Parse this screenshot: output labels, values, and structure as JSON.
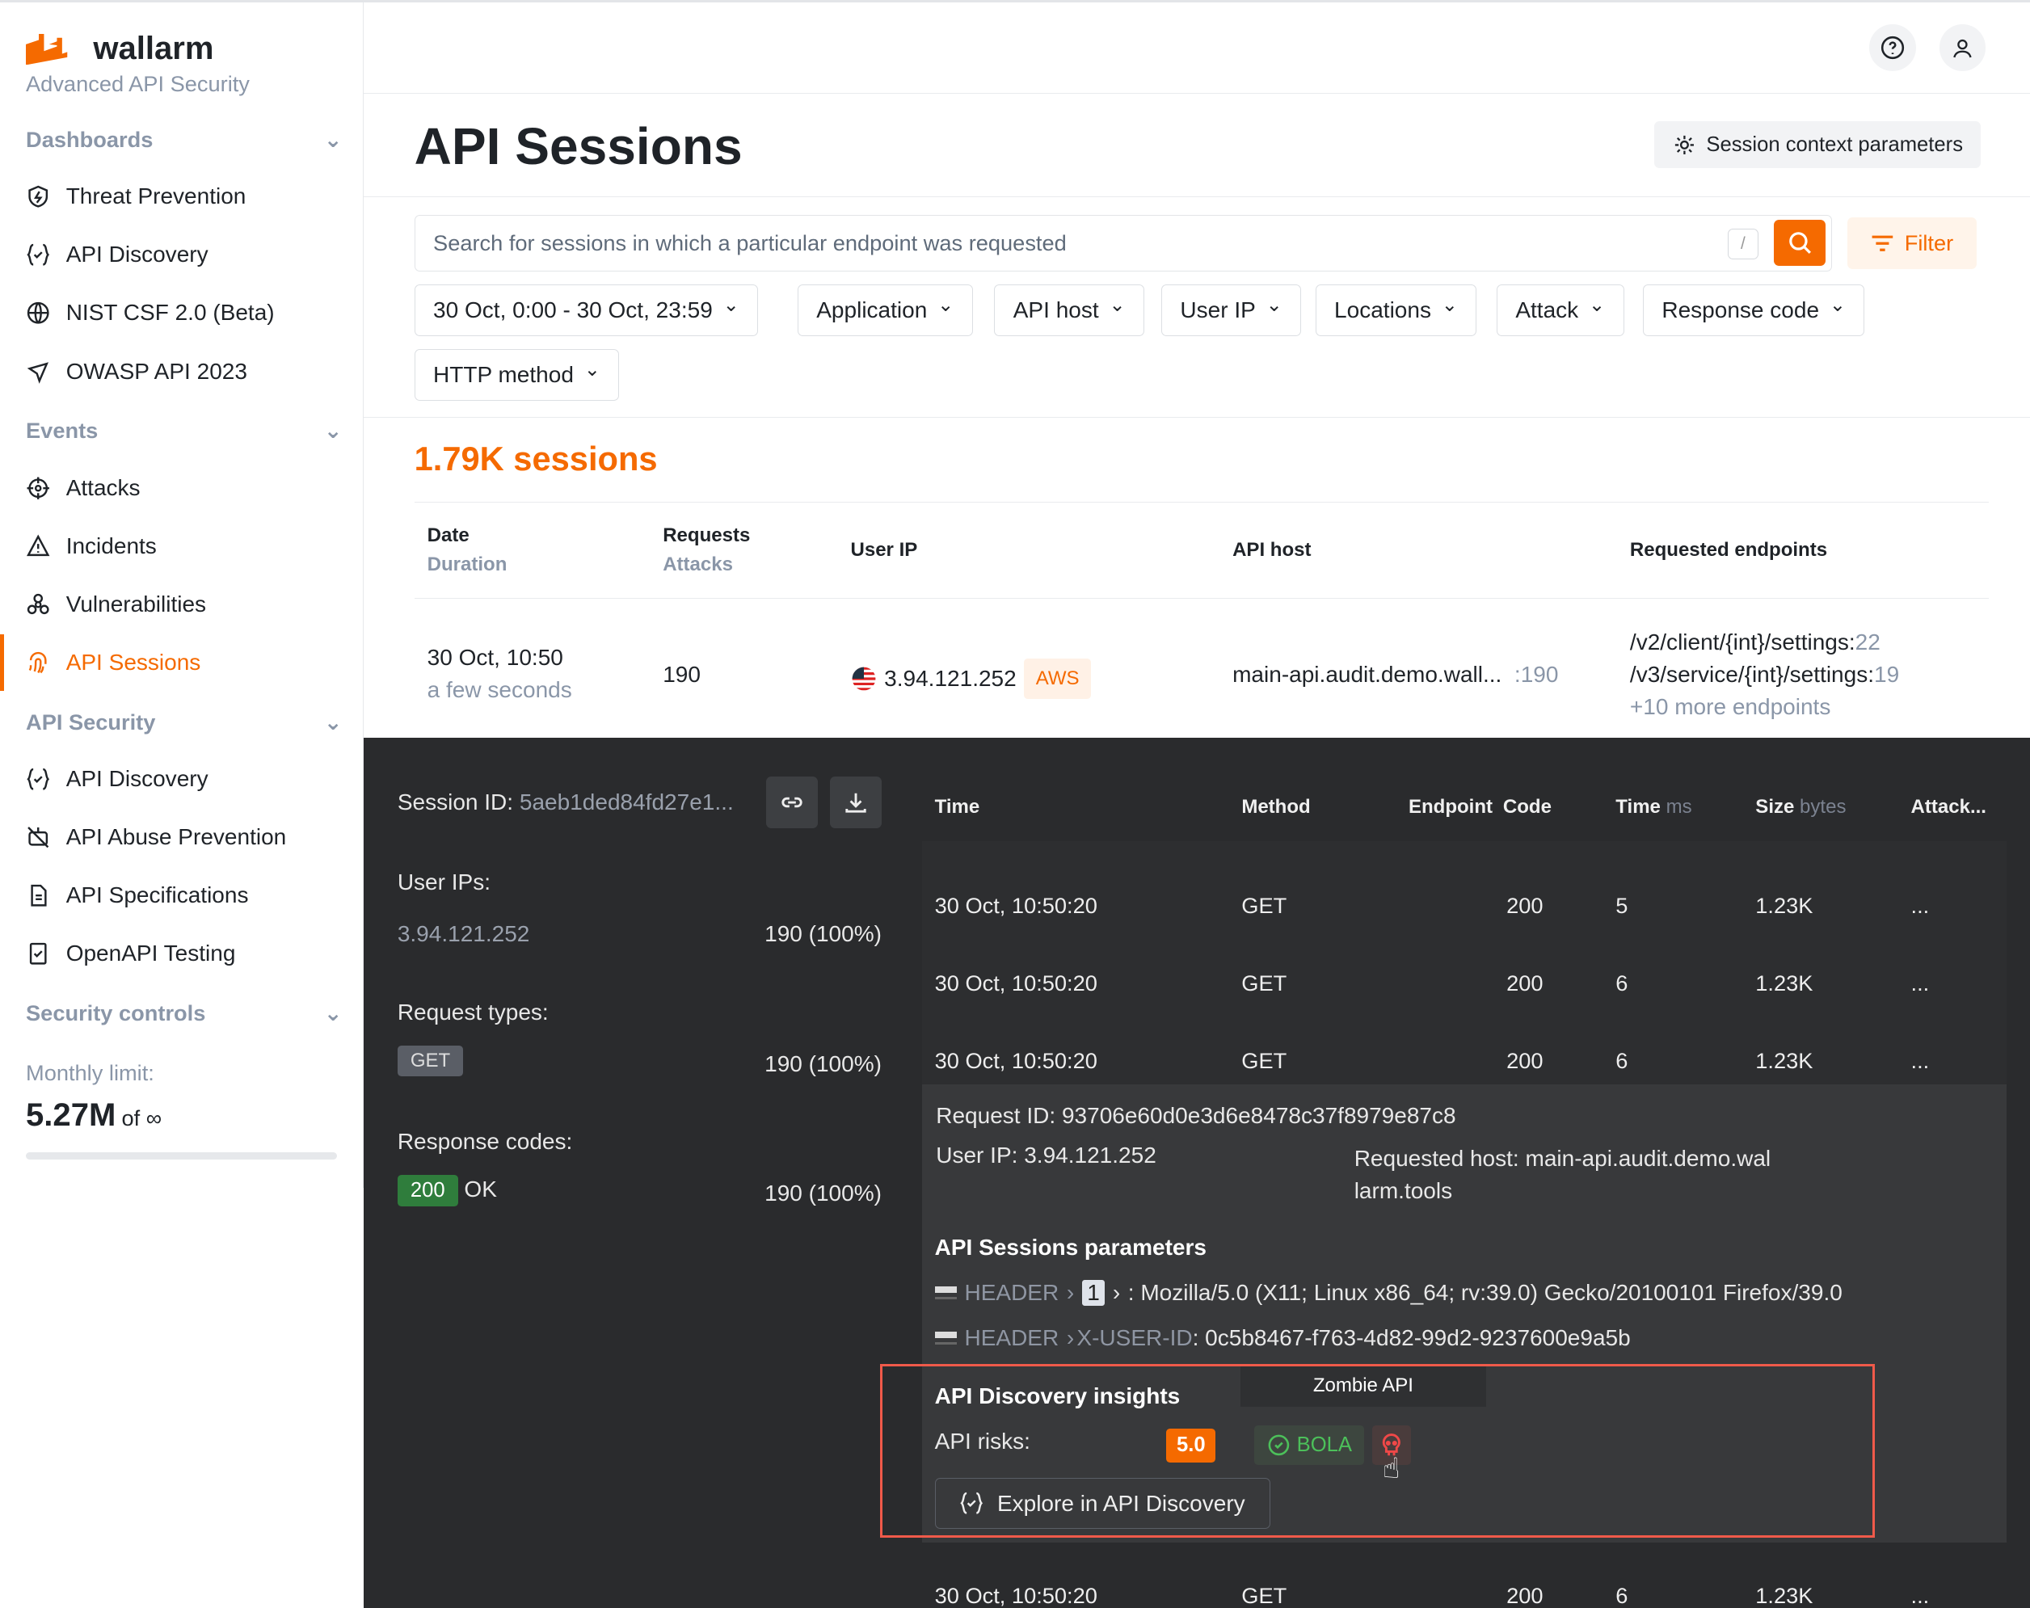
{
  "brand": {
    "name": "wallarm",
    "tagline": "Advanced API Security",
    "accent": "#f56a00"
  },
  "sidebar": {
    "sections": [
      {
        "label": "Dashboards"
      },
      {
        "label": "Events"
      },
      {
        "label": "API Security"
      },
      {
        "label": "Security controls"
      }
    ],
    "items": [
      {
        "label": "Threat Prevention",
        "icon": "shield-bolt-icon"
      },
      {
        "label": "API Discovery",
        "icon": "api-braces-icon"
      },
      {
        "label": "NIST CSF 2.0 (Beta)",
        "icon": "globe-icon"
      },
      {
        "label": "OWASP API 2023",
        "icon": "owasp-icon"
      },
      {
        "label": "Attacks",
        "icon": "crosshair-icon"
      },
      {
        "label": "Incidents",
        "icon": "warning-icon"
      },
      {
        "label": "Vulnerabilities",
        "icon": "biohazard-icon"
      },
      {
        "label": "API Sessions",
        "icon": "fingerprint-icon",
        "active": true
      },
      {
        "label": "API Discovery",
        "icon": "api-braces-icon"
      },
      {
        "label": "API Abuse Prevention",
        "icon": "bot-icon"
      },
      {
        "label": "API Specifications",
        "icon": "document-icon"
      },
      {
        "label": "OpenAPI Testing",
        "icon": "checklist-icon"
      }
    ],
    "limit_label": "Monthly limit:",
    "limit_value": "5.27M",
    "limit_of": "of ∞"
  },
  "header": {
    "title": "API Sessions",
    "context_button": "Session context parameters"
  },
  "search": {
    "placeholder": "Search for sessions in which a particular endpoint was requested",
    "shortcut": "/",
    "filter_label": "Filter"
  },
  "filters": [
    "30 Oct, 0:00 - 30 Oct, 23:59",
    "Application",
    "API host",
    "User IP",
    "Locations",
    "Attack",
    "Response code",
    "HTTP method"
  ],
  "sessions_count": "1.79K sessions",
  "table": {
    "headers": [
      {
        "main": "Date",
        "sub": "Duration"
      },
      {
        "main": "Requests",
        "sub": "Attacks"
      },
      {
        "main": "User IP"
      },
      {
        "main": "API host"
      },
      {
        "main": "Requested endpoints"
      }
    ],
    "row": {
      "date": "30 Oct, 10:50",
      "duration": "a few seconds",
      "requests": "190",
      "ip": "3.94.121.252",
      "ip_tag": "AWS",
      "host": "main-api.audit.demo.wall...",
      "host_count": ":190",
      "endpoints": [
        {
          "path": "/v2/client/{int}/settings:",
          "count": "22"
        },
        {
          "path": "/v3/service/{int}/settings:",
          "count": "19"
        }
      ],
      "more": "+10 more endpoints"
    }
  },
  "session": {
    "id_label": "Session ID:",
    "id": "5aeb1ded84fd27e1...",
    "user_ips_label": "User IPs:",
    "user_ip": "3.94.121.252",
    "user_ip_share": "190 (100%)",
    "request_types_label": "Request types:",
    "request_type": "GET",
    "request_type_share": "190 (100%)",
    "response_codes_label": "Response codes:",
    "response_code": "200",
    "response_text": "OK",
    "response_share": "190 (100%)"
  },
  "requests": {
    "headers": {
      "time": "Time",
      "method": "Method",
      "endpoint": "Endpoint",
      "code": "Code",
      "duration": "Time",
      "duration_unit": "ms",
      "size": "Size",
      "size_unit": "bytes",
      "attack": "Attack..."
    },
    "rows": [
      {
        "time": "30 Oct, 10:50:20",
        "method": "GET",
        "code": "200",
        "ms": "5",
        "size": "1.23K",
        "attack": "..."
      },
      {
        "time": "30 Oct, 10:50:20",
        "method": "GET",
        "code": "200",
        "ms": "6",
        "size": "1.23K",
        "attack": "..."
      },
      {
        "time": "30 Oct, 10:50:20",
        "method": "GET",
        "code": "200",
        "ms": "6",
        "size": "1.23K",
        "attack": "..."
      },
      {
        "time": "30 Oct, 10:50:20",
        "method": "GET",
        "code": "200",
        "ms": "6",
        "size": "1.23K",
        "attack": "..."
      }
    ],
    "detail": {
      "request_id": "Request ID: 93706e60d0e3d6e8478c37f8979e87c8",
      "user_ip": "User IP: 3.94.121.252",
      "host": "Requested host: main-api.audit.demo.wal larm.tools",
      "params_title": "API Sessions parameters",
      "params": [
        {
          "source": "HEADER",
          "key": "1",
          "value": ": Mozilla/5.0 (X11; Linux x86_64; rv:39.0) Gecko/20100101 Firefox/39.0"
        },
        {
          "source": "HEADER",
          "key": "X-USER-ID",
          "value": ": 0c5b8467-f763-4d82-99d2-9237600e9a5b"
        }
      ],
      "insights_title": "API Discovery insights",
      "risks_label": "API risks:",
      "risk_score": "5.0",
      "bola": "BOLA",
      "tooltip": "Zombie API",
      "explore_button": "Explore in API Discovery"
    }
  }
}
